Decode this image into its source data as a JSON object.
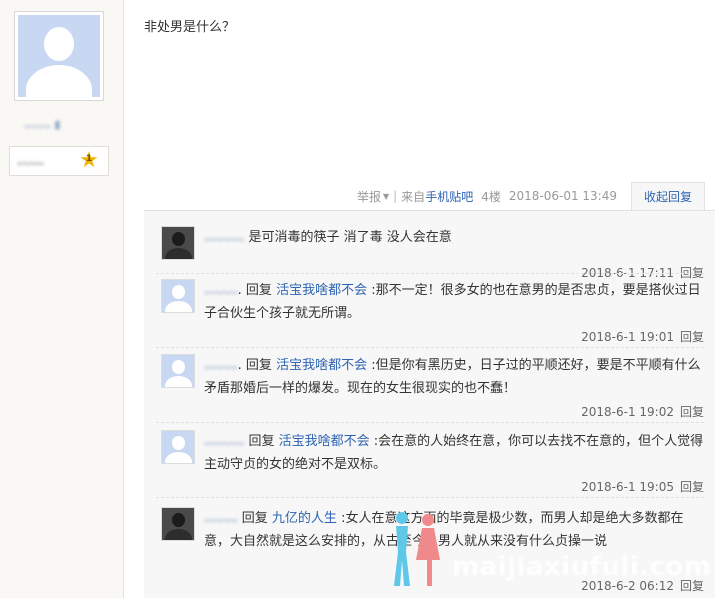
{
  "user": {
    "name_blurred": "ᴗᴗᴗᴗ ▮",
    "level_blurred": "ᴗᴗᴗᴗ",
    "level_number": "1"
  },
  "post": {
    "text": "非处男是什么？"
  },
  "meta": {
    "report": "举报",
    "from": "来自",
    "client": "手机贴吧",
    "floor": "4楼",
    "datetime": "2018-06-01 13:49",
    "collapse": "收起回复"
  },
  "replies": [
    {
      "name": "ᴗᴗᴗᴗᴗᴗ",
      "pre": "",
      "target": "",
      "text": "是可消毒的筷子 消了毒 没人会在意",
      "time": "2018-6-1 17:11",
      "reply_btn": "回复"
    },
    {
      "name": "ᴗᴗᴗᴗᴗ",
      "pre": ". 回复 ",
      "target": "活宝我啥都不会",
      "text": " :那不一定！很多女的也在意男的是否忠贞，要是搭伙过日子合伙生个孩子就无所谓。",
      "time": "2018-6-1 19:01",
      "reply_btn": "回复"
    },
    {
      "name": "ᴗᴗᴗᴗᴗ",
      "pre": ". 回复 ",
      "target": "活宝我啥都不会",
      "text": " :但是你有黑历史，日子过的平顺还好，要是不平顺有什么矛盾那婚后一样的爆发。现在的女生很现实的也不蠢！",
      "time": "2018-6-1 19:02",
      "reply_btn": "回复"
    },
    {
      "name": "ᴗᴗᴗᴗᴗᴗ",
      "pre": " 回复 ",
      "target": "活宝我啥都不会",
      "text": " :会在意的人始终在意，你可以去找不在意的，但个人觉得主动守贞的女的绝对不是双标。",
      "time": "2018-6-1 19:05",
      "reply_btn": "回复"
    },
    {
      "name": "ᴗᴗᴗᴗᴗ",
      "pre": " 回复 ",
      "target": "九亿的人生",
      "text": " :女人在意这方面的毕竟是极少数，而男人却是绝大多数都在意，大自然就是这么安排的，从古至今，男人就从来没有什么贞操一说",
      "time": "2018-6-2 06:12",
      "reply_btn": "回复"
    }
  ],
  "watermark": {
    "text": "maijiaxiufuli.com"
  }
}
